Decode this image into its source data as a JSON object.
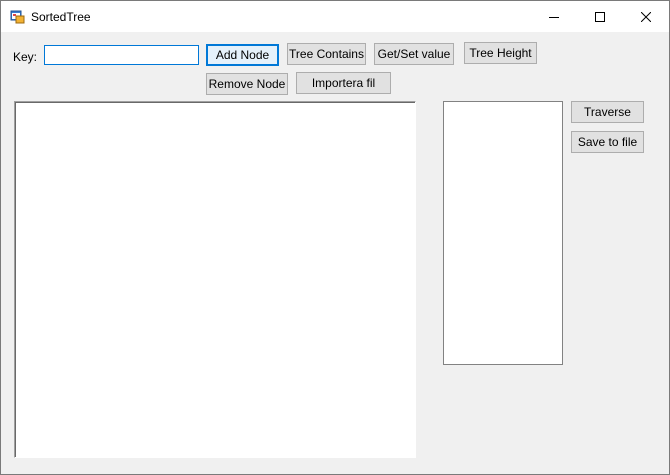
{
  "window": {
    "title": "SortedTree",
    "icon": "app-form-icon",
    "controls": [
      "minimize-icon",
      "maximize-icon",
      "close-icon"
    ]
  },
  "form": {
    "key_label": "Key:",
    "key_value": "",
    "buttons": {
      "add_node": "Add Node",
      "tree_contains": "Tree Contains",
      "get_set_value": "Get/Set value",
      "tree_height": "Tree Height",
      "remove_node": "Remove Node",
      "importera_fil": "Importera fil",
      "traverse": "Traverse",
      "save_to_file": "Save to file"
    }
  },
  "colors": {
    "focus_accent": "#0078d7",
    "form_background": "#f0f0f0",
    "button_face": "#e1e1e1"
  }
}
